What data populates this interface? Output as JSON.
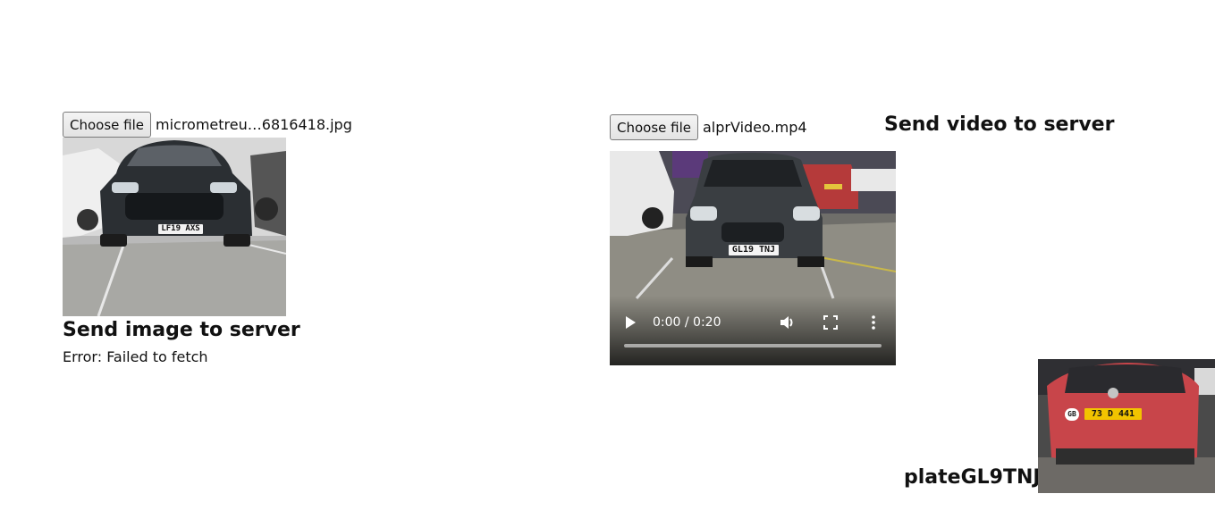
{
  "image_panel": {
    "choose_file_label": "Choose file",
    "file_name": "micrometreu…6816418.jpg",
    "plate_text": "LF19 AXS",
    "send_heading": "Send image to server",
    "error_text": "Error: Failed to fetch"
  },
  "video_panel": {
    "choose_file_label": "Choose file",
    "file_name": "alprVideo.mp4",
    "send_heading": "Send video to server",
    "plate_text": "GL19 TNJ",
    "time_display": "0:00 / 0:20",
    "progress": 0
  },
  "result_panel": {
    "plate_heading": "plateGL9TNJ",
    "thumbnail_plate_text": "73 D 441",
    "thumbnail_badge": "GB"
  },
  "icons": [
    "play-icon",
    "volume-icon",
    "fullscreen-icon",
    "more-options-icon"
  ]
}
